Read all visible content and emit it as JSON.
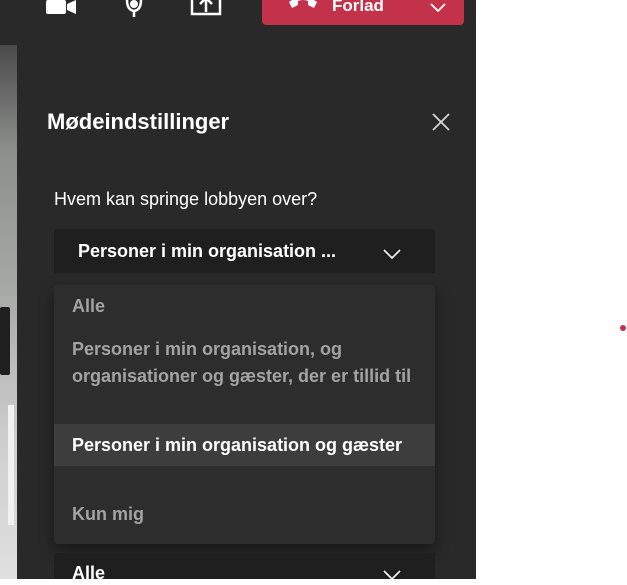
{
  "toolbar": {
    "icons": [
      "camera-icon",
      "microphone-icon",
      "share-screen-icon"
    ],
    "leave_label": "Forlad",
    "leave_color": "#c4314b"
  },
  "panel": {
    "title": "Mødeindstillinger",
    "question": "Hvem kan springe lobbyen over?",
    "select_value": "Personer i min organisation ...",
    "options": [
      {
        "label": "Alle",
        "selected": false
      },
      {
        "label": "Personer i min organisation, og organisationer og gæster, der er tillid til",
        "selected": false
      },
      {
        "label": "Personer i min organisation og gæster",
        "selected": true
      },
      {
        "label": "Kun mig",
        "selected": false
      }
    ],
    "second_select_value": "Alle"
  }
}
